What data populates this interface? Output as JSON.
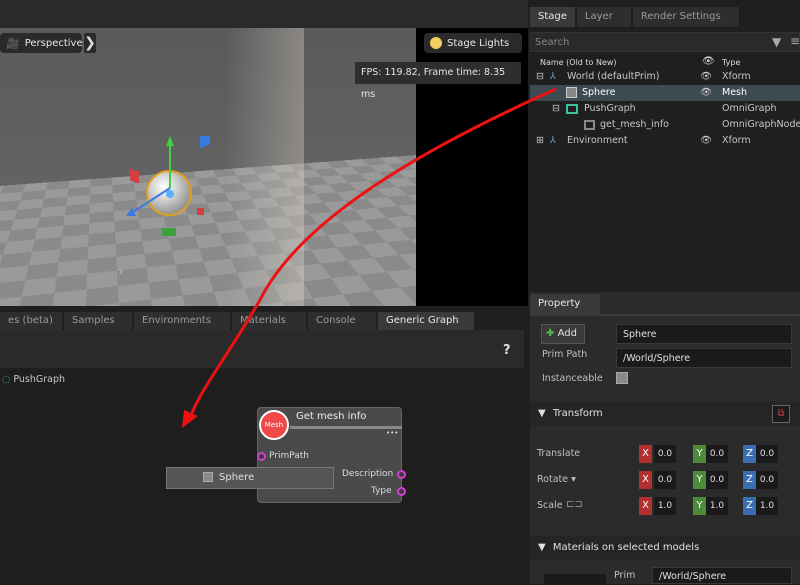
{
  "viewport": {
    "camera_label": "Perspective",
    "lights_label": "Stage Lights",
    "fps_text": "FPS: 119.82, Frame time: 8.35 ms"
  },
  "stage": {
    "tabs": [
      "Stage",
      "Layer",
      "Render Settings"
    ],
    "search_placeholder": "Search",
    "col_name": "Name (Old to New)",
    "col_type": "Type",
    "rows": [
      {
        "name": "World (defaultPrim)",
        "type": "Xform"
      },
      {
        "name": "Sphere",
        "type": "Mesh"
      },
      {
        "name": "PushGraph",
        "type": "OmniGraph"
      },
      {
        "name": "get_mesh_info",
        "type": "OmniGraphNode"
      },
      {
        "name": "Environment",
        "type": "Xform"
      }
    ]
  },
  "property": {
    "tab": "Property",
    "add_label": "Add",
    "name_value": "Sphere",
    "prim_path_label": "Prim Path",
    "prim_path_value": "/World/Sphere",
    "instanceable_label": "Instanceable",
    "transform_label": "Transform",
    "translate_label": "Translate",
    "rotate_label": "Rotate",
    "scale_label": "Scale",
    "translate": [
      "0.0",
      "0.0",
      "0.0"
    ],
    "rotate": [
      "0.0",
      "0.0",
      "0.0"
    ],
    "scale": [
      "1.0",
      "1.0",
      "1.0"
    ],
    "axis_x": "X",
    "axis_y": "Y",
    "axis_z": "Z",
    "materials_label": "Materials on selected models",
    "prim_label": "Prim",
    "materials_prim_value": "/World/Sphere"
  },
  "graph": {
    "tabs": [
      "es (beta)",
      "Samples",
      "Environments",
      "Materials",
      "Console",
      "Generic Graph"
    ],
    "help": "?",
    "graph_name": "PushGraph",
    "node_title": "Get mesh info",
    "node_menu": "•••",
    "node_icon_text": "Mesh",
    "input_primpath": "PrimPath",
    "output_description": "Description",
    "output_type": "Type",
    "sphere_node_label": "Sphere"
  },
  "colors": {
    "accent_red": "#ee1111",
    "selection": "#3c4a52",
    "port": "#d040d0"
  }
}
